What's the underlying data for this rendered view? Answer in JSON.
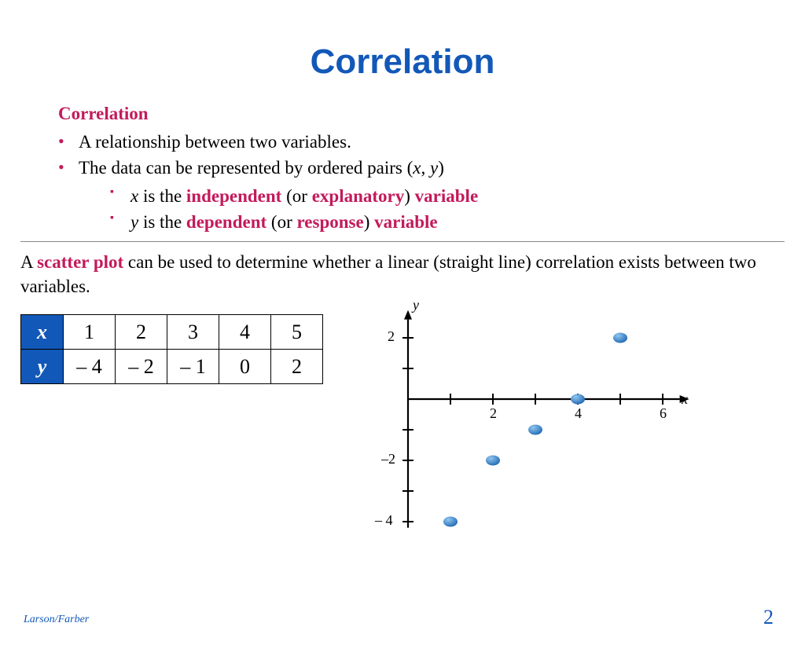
{
  "title": "Correlation",
  "subheading": "Correlation",
  "bullets": {
    "b1": "A relationship between two variables.",
    "b2_before": "The data can be represented by ordered pairs (",
    "b2_x": "x",
    "b2_mid": ", ",
    "b2_y": "y",
    "b2_after": ")",
    "s1_var": "x",
    "s1_a": " is the ",
    "s1_b": "independent",
    "s1_c": " (or ",
    "s1_d": "explanatory",
    "s1_e": ") ",
    "s1_f": "variable",
    "s2_var": "y",
    "s2_a": " is the ",
    "s2_b": "dependent",
    "s2_c": " (or ",
    "s2_d": "response",
    "s2_e": ") ",
    "s2_f": "variable"
  },
  "para": {
    "a": "A ",
    "b": "scatter plot",
    "c": " can be used to determine whether a linear (straight line) correlation exists between two variables."
  },
  "table": {
    "x_label": "x",
    "y_label": "y",
    "x": [
      "1",
      "2",
      "3",
      "4",
      "5"
    ],
    "y": [
      "– 4",
      "– 2",
      "– 1",
      "0",
      "2"
    ]
  },
  "chart_data": {
    "type": "scatter",
    "title": "",
    "xlabel": "x",
    "ylabel": "y",
    "xlim": [
      0,
      6
    ],
    "ylim": [
      -4,
      2
    ],
    "x_ticks": [
      2,
      4,
      6
    ],
    "y_ticks_pos": [
      2
    ],
    "y_ticks_neg": [
      "–2",
      "– 4"
    ],
    "points": [
      {
        "x": 1,
        "y": -4
      },
      {
        "x": 2,
        "y": -2
      },
      {
        "x": 3,
        "y": -1
      },
      {
        "x": 4,
        "y": 0
      },
      {
        "x": 5,
        "y": 2
      }
    ]
  },
  "footer": {
    "left": "Larson/Farber",
    "right": "2"
  }
}
